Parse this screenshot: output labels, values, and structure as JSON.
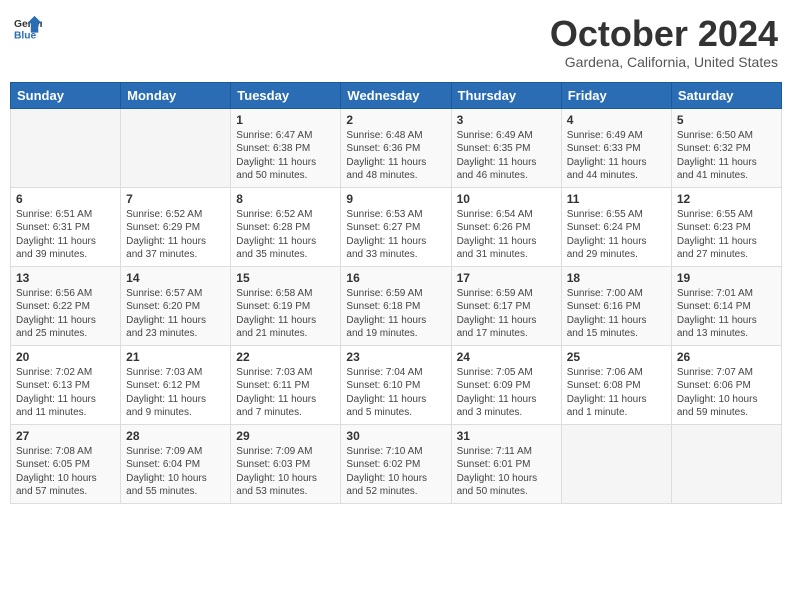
{
  "header": {
    "logo_general": "General",
    "logo_blue": "Blue",
    "month_title": "October 2024",
    "location": "Gardena, California, United States"
  },
  "weekdays": [
    "Sunday",
    "Monday",
    "Tuesday",
    "Wednesday",
    "Thursday",
    "Friday",
    "Saturday"
  ],
  "weeks": [
    [
      {
        "day": "",
        "sunrise": "",
        "sunset": "",
        "daylight": ""
      },
      {
        "day": "",
        "sunrise": "",
        "sunset": "",
        "daylight": ""
      },
      {
        "day": "1",
        "sunrise": "Sunrise: 6:47 AM",
        "sunset": "Sunset: 6:38 PM",
        "daylight": "Daylight: 11 hours and 50 minutes."
      },
      {
        "day": "2",
        "sunrise": "Sunrise: 6:48 AM",
        "sunset": "Sunset: 6:36 PM",
        "daylight": "Daylight: 11 hours and 48 minutes."
      },
      {
        "day": "3",
        "sunrise": "Sunrise: 6:49 AM",
        "sunset": "Sunset: 6:35 PM",
        "daylight": "Daylight: 11 hours and 46 minutes."
      },
      {
        "day": "4",
        "sunrise": "Sunrise: 6:49 AM",
        "sunset": "Sunset: 6:33 PM",
        "daylight": "Daylight: 11 hours and 44 minutes."
      },
      {
        "day": "5",
        "sunrise": "Sunrise: 6:50 AM",
        "sunset": "Sunset: 6:32 PM",
        "daylight": "Daylight: 11 hours and 41 minutes."
      }
    ],
    [
      {
        "day": "6",
        "sunrise": "Sunrise: 6:51 AM",
        "sunset": "Sunset: 6:31 PM",
        "daylight": "Daylight: 11 hours and 39 minutes."
      },
      {
        "day": "7",
        "sunrise": "Sunrise: 6:52 AM",
        "sunset": "Sunset: 6:29 PM",
        "daylight": "Daylight: 11 hours and 37 minutes."
      },
      {
        "day": "8",
        "sunrise": "Sunrise: 6:52 AM",
        "sunset": "Sunset: 6:28 PM",
        "daylight": "Daylight: 11 hours and 35 minutes."
      },
      {
        "day": "9",
        "sunrise": "Sunrise: 6:53 AM",
        "sunset": "Sunset: 6:27 PM",
        "daylight": "Daylight: 11 hours and 33 minutes."
      },
      {
        "day": "10",
        "sunrise": "Sunrise: 6:54 AM",
        "sunset": "Sunset: 6:26 PM",
        "daylight": "Daylight: 11 hours and 31 minutes."
      },
      {
        "day": "11",
        "sunrise": "Sunrise: 6:55 AM",
        "sunset": "Sunset: 6:24 PM",
        "daylight": "Daylight: 11 hours and 29 minutes."
      },
      {
        "day": "12",
        "sunrise": "Sunrise: 6:55 AM",
        "sunset": "Sunset: 6:23 PM",
        "daylight": "Daylight: 11 hours and 27 minutes."
      }
    ],
    [
      {
        "day": "13",
        "sunrise": "Sunrise: 6:56 AM",
        "sunset": "Sunset: 6:22 PM",
        "daylight": "Daylight: 11 hours and 25 minutes."
      },
      {
        "day": "14",
        "sunrise": "Sunrise: 6:57 AM",
        "sunset": "Sunset: 6:20 PM",
        "daylight": "Daylight: 11 hours and 23 minutes."
      },
      {
        "day": "15",
        "sunrise": "Sunrise: 6:58 AM",
        "sunset": "Sunset: 6:19 PM",
        "daylight": "Daylight: 11 hours and 21 minutes."
      },
      {
        "day": "16",
        "sunrise": "Sunrise: 6:59 AM",
        "sunset": "Sunset: 6:18 PM",
        "daylight": "Daylight: 11 hours and 19 minutes."
      },
      {
        "day": "17",
        "sunrise": "Sunrise: 6:59 AM",
        "sunset": "Sunset: 6:17 PM",
        "daylight": "Daylight: 11 hours and 17 minutes."
      },
      {
        "day": "18",
        "sunrise": "Sunrise: 7:00 AM",
        "sunset": "Sunset: 6:16 PM",
        "daylight": "Daylight: 11 hours and 15 minutes."
      },
      {
        "day": "19",
        "sunrise": "Sunrise: 7:01 AM",
        "sunset": "Sunset: 6:14 PM",
        "daylight": "Daylight: 11 hours and 13 minutes."
      }
    ],
    [
      {
        "day": "20",
        "sunrise": "Sunrise: 7:02 AM",
        "sunset": "Sunset: 6:13 PM",
        "daylight": "Daylight: 11 hours and 11 minutes."
      },
      {
        "day": "21",
        "sunrise": "Sunrise: 7:03 AM",
        "sunset": "Sunset: 6:12 PM",
        "daylight": "Daylight: 11 hours and 9 minutes."
      },
      {
        "day": "22",
        "sunrise": "Sunrise: 7:03 AM",
        "sunset": "Sunset: 6:11 PM",
        "daylight": "Daylight: 11 hours and 7 minutes."
      },
      {
        "day": "23",
        "sunrise": "Sunrise: 7:04 AM",
        "sunset": "Sunset: 6:10 PM",
        "daylight": "Daylight: 11 hours and 5 minutes."
      },
      {
        "day": "24",
        "sunrise": "Sunrise: 7:05 AM",
        "sunset": "Sunset: 6:09 PM",
        "daylight": "Daylight: 11 hours and 3 minutes."
      },
      {
        "day": "25",
        "sunrise": "Sunrise: 7:06 AM",
        "sunset": "Sunset: 6:08 PM",
        "daylight": "Daylight: 11 hours and 1 minute."
      },
      {
        "day": "26",
        "sunrise": "Sunrise: 7:07 AM",
        "sunset": "Sunset: 6:06 PM",
        "daylight": "Daylight: 10 hours and 59 minutes."
      }
    ],
    [
      {
        "day": "27",
        "sunrise": "Sunrise: 7:08 AM",
        "sunset": "Sunset: 6:05 PM",
        "daylight": "Daylight: 10 hours and 57 minutes."
      },
      {
        "day": "28",
        "sunrise": "Sunrise: 7:09 AM",
        "sunset": "Sunset: 6:04 PM",
        "daylight": "Daylight: 10 hours and 55 minutes."
      },
      {
        "day": "29",
        "sunrise": "Sunrise: 7:09 AM",
        "sunset": "Sunset: 6:03 PM",
        "daylight": "Daylight: 10 hours and 53 minutes."
      },
      {
        "day": "30",
        "sunrise": "Sunrise: 7:10 AM",
        "sunset": "Sunset: 6:02 PM",
        "daylight": "Daylight: 10 hours and 52 minutes."
      },
      {
        "day": "31",
        "sunrise": "Sunrise: 7:11 AM",
        "sunset": "Sunset: 6:01 PM",
        "daylight": "Daylight: 10 hours and 50 minutes."
      },
      {
        "day": "",
        "sunrise": "",
        "sunset": "",
        "daylight": ""
      },
      {
        "day": "",
        "sunrise": "",
        "sunset": "",
        "daylight": ""
      }
    ]
  ]
}
